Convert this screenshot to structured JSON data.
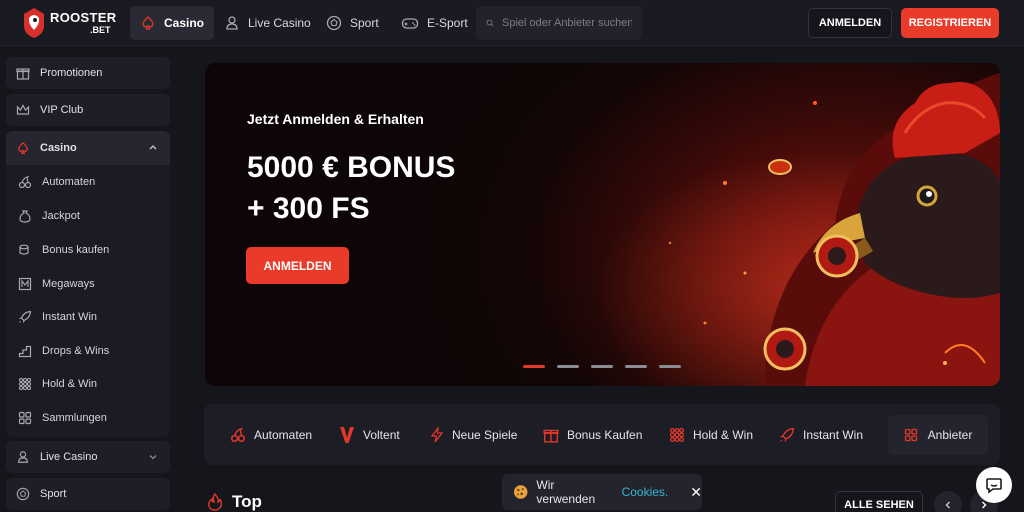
{
  "brand": {
    "name": "ROOSTER",
    "suffix": ".BET",
    "accent": "#ea3a2a"
  },
  "header": {
    "nav": [
      {
        "label": "Casino",
        "icon": "spade-icon",
        "active": true
      },
      {
        "label": "Live Casino",
        "icon": "dealer-icon",
        "active": false
      },
      {
        "label": "Sport",
        "icon": "soccer-ball-icon",
        "active": false
      },
      {
        "label": "E-Sport",
        "icon": "gamepad-icon",
        "active": false
      }
    ],
    "search_placeholder": "Spiel oder Anbieter suchen",
    "login_label": "ANMELDEN",
    "register_label": "REGISTRIEREN"
  },
  "sidebar": {
    "items": [
      {
        "label": "Promotionen",
        "icon": "gift-icon"
      },
      {
        "label": "VIP Club",
        "icon": "crown-icon"
      },
      {
        "label": "Casino",
        "icon": "spade-icon",
        "expanded": true
      },
      {
        "label": "Live Casino",
        "icon": "dealer-icon",
        "expanded": false
      },
      {
        "label": "Sport",
        "icon": "soccer-ball-icon"
      }
    ],
    "casino_sub": [
      {
        "label": "Automaten",
        "icon": "cherries-icon"
      },
      {
        "label": "Jackpot",
        "icon": "money-bag-icon"
      },
      {
        "label": "Bonus kaufen",
        "icon": "coins-icon"
      },
      {
        "label": "Megaways",
        "icon": "grid-m-icon"
      },
      {
        "label": "Instant Win",
        "icon": "rocket-icon"
      },
      {
        "label": "Drops & Wins",
        "icon": "stairs-icon"
      },
      {
        "label": "Hold & Win",
        "icon": "grid-dots-icon"
      },
      {
        "label": "Sammlungen",
        "icon": "collection-icon"
      }
    ]
  },
  "banner": {
    "kicker": "Jetzt Anmelden & Erhalten",
    "title_line1": "5000 € BONUS",
    "title_line2": "+ 300 FS",
    "cta": "ANMELDEN",
    "slides_total": 5,
    "active_slide": 1
  },
  "categories": [
    {
      "label": "Automaten",
      "icon": "cherries-icon"
    },
    {
      "label": "Voltent",
      "icon": "voltent-v-icon"
    },
    {
      "label": "Neue Spiele",
      "icon": "lightning-icon"
    },
    {
      "label": "Bonus Kaufen",
      "icon": "gift-box-icon"
    },
    {
      "label": "Hold & Win",
      "icon": "grid-dots-icon"
    },
    {
      "label": "Instant Win",
      "icon": "rocket-icon"
    }
  ],
  "providers_label": "Anbieter",
  "section": {
    "title": "Top",
    "see_all": "ALLE SEHEN"
  },
  "cookie": {
    "text": "Wir verwenden",
    "link": "Cookies."
  }
}
